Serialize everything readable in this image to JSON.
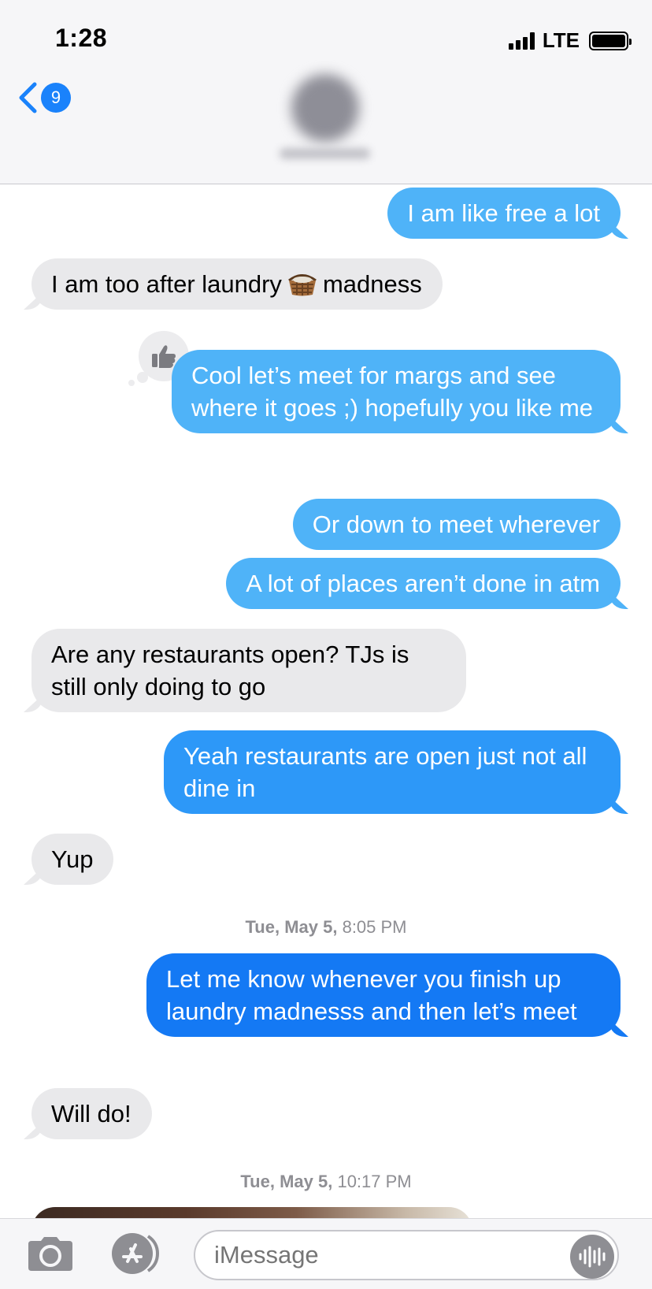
{
  "status_bar": {
    "time": "1:28",
    "network": "LTE"
  },
  "nav": {
    "back_badge": "9"
  },
  "messages": [
    {
      "type": "sent",
      "text": "I am like free a lot"
    },
    {
      "type": "received",
      "text_before": "I am too after laundry",
      "emoji": "laundry-basket",
      "text_after": "madness"
    },
    {
      "type": "sent",
      "text": "Cool let’s meet for margs and see where it goes ;) hopefully you like me",
      "reaction": "thumbs-up"
    },
    {
      "type": "sent",
      "text": "Or down to meet wherever"
    },
    {
      "type": "sent",
      "text": "A lot of places aren’t done in atm"
    },
    {
      "type": "received",
      "text": "Are any restaurants open? TJs is still only doing to go"
    },
    {
      "type": "sent",
      "text": "Yeah restaurants are open just not all dine in"
    },
    {
      "type": "received",
      "text": "Yup"
    },
    {
      "type": "timestamp",
      "day": "Tue, May 5,",
      "time": "8:05 PM"
    },
    {
      "type": "sent",
      "text": "Let me know whenever you finish up laundry madnesss and then let’s meet"
    },
    {
      "type": "received",
      "text": "Will do!"
    },
    {
      "type": "timestamp",
      "day": "Tue, May 5,",
      "time": "10:17 PM"
    }
  ],
  "input": {
    "placeholder": "iMessage"
  },
  "colors": {
    "sent_light": "#4fb3f8",
    "sent": "#1c8cf6",
    "sent_deep": "#1479f4",
    "received": "#e9e9eb",
    "accent": "#1a82fb"
  },
  "icons": [
    "back-chevron-icon",
    "thumbs-up-icon",
    "laundry-basket-emoji",
    "camera-icon",
    "app-store-icon",
    "audio-waveform-icon"
  ]
}
